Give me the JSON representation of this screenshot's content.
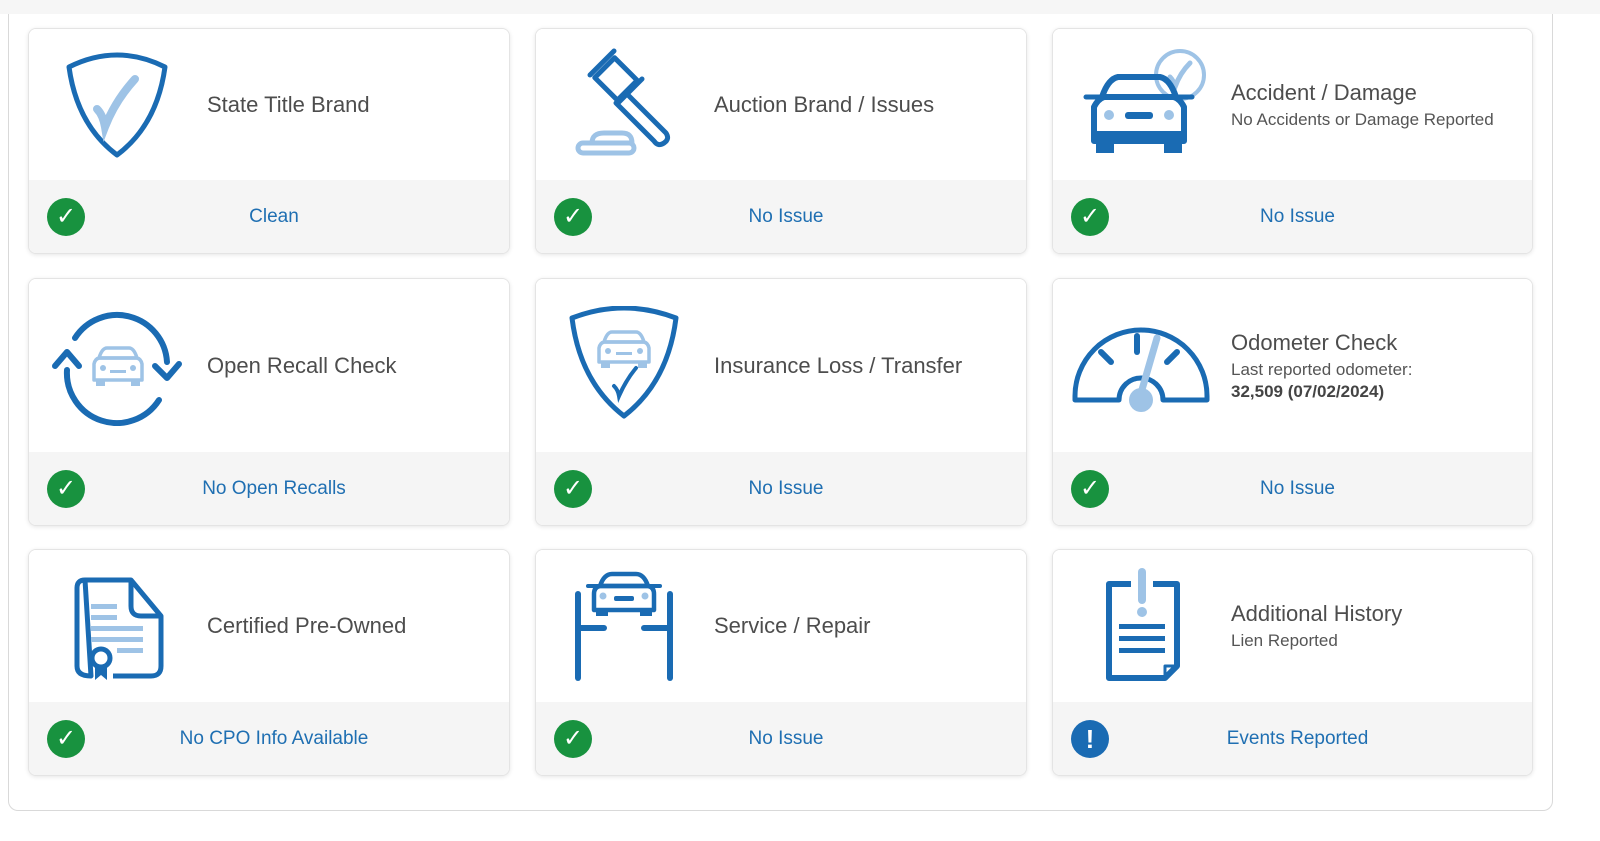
{
  "colors": {
    "icon_primary": "#1a6bb3",
    "icon_secondary": "#9ec3e6",
    "status_ok": "#18923f",
    "status_warn": "#1a6bb3",
    "status_text": "#1f6fb2"
  },
  "cards": [
    {
      "title": "State Title Brand",
      "icon": "shield-check-icon",
      "status": "Clean",
      "status_type": "ok",
      "status_icon": "check-circle-icon"
    },
    {
      "title": "Auction Brand / Issues",
      "icon": "gavel-icon",
      "status": "No Issue",
      "status_type": "ok",
      "status_icon": "check-circle-icon"
    },
    {
      "title": "Accident / Damage",
      "subtitle": "No Accidents or Damage Reported",
      "icon": "car-check-icon",
      "status": "No Issue",
      "status_type": "ok",
      "status_icon": "check-circle-icon"
    },
    {
      "title": "Open Recall Check",
      "icon": "car-recall-cycle-icon",
      "status": "No Open Recalls",
      "status_type": "ok",
      "status_icon": "check-circle-icon"
    },
    {
      "title": "Insurance Loss / Transfer",
      "icon": "shield-car-icon",
      "status": "No Issue",
      "status_type": "ok",
      "status_icon": "check-circle-icon"
    },
    {
      "title": "Odometer Check",
      "subtitle": "Last reported odometer:",
      "subtitle_strong": "32,509 (07/02/2024)",
      "icon": "odometer-gauge-icon",
      "status": "No Issue",
      "status_type": "ok",
      "status_icon": "check-circle-icon"
    },
    {
      "title": "Certified Pre-Owned",
      "icon": "certificate-document-icon",
      "status": "No CPO Info Available",
      "status_type": "ok",
      "status_icon": "check-circle-icon"
    },
    {
      "title": "Service / Repair",
      "icon": "car-lift-icon",
      "status": "No Issue",
      "status_type": "ok",
      "status_icon": "check-circle-icon"
    },
    {
      "title": "Additional History",
      "subtitle": "Lien Reported",
      "icon": "clipboard-alert-icon",
      "status": "Events Reported",
      "status_type": "warn",
      "status_icon": "exclamation-circle-icon"
    }
  ],
  "glyphs": {
    "check": "✓",
    "exclamation": "!"
  }
}
